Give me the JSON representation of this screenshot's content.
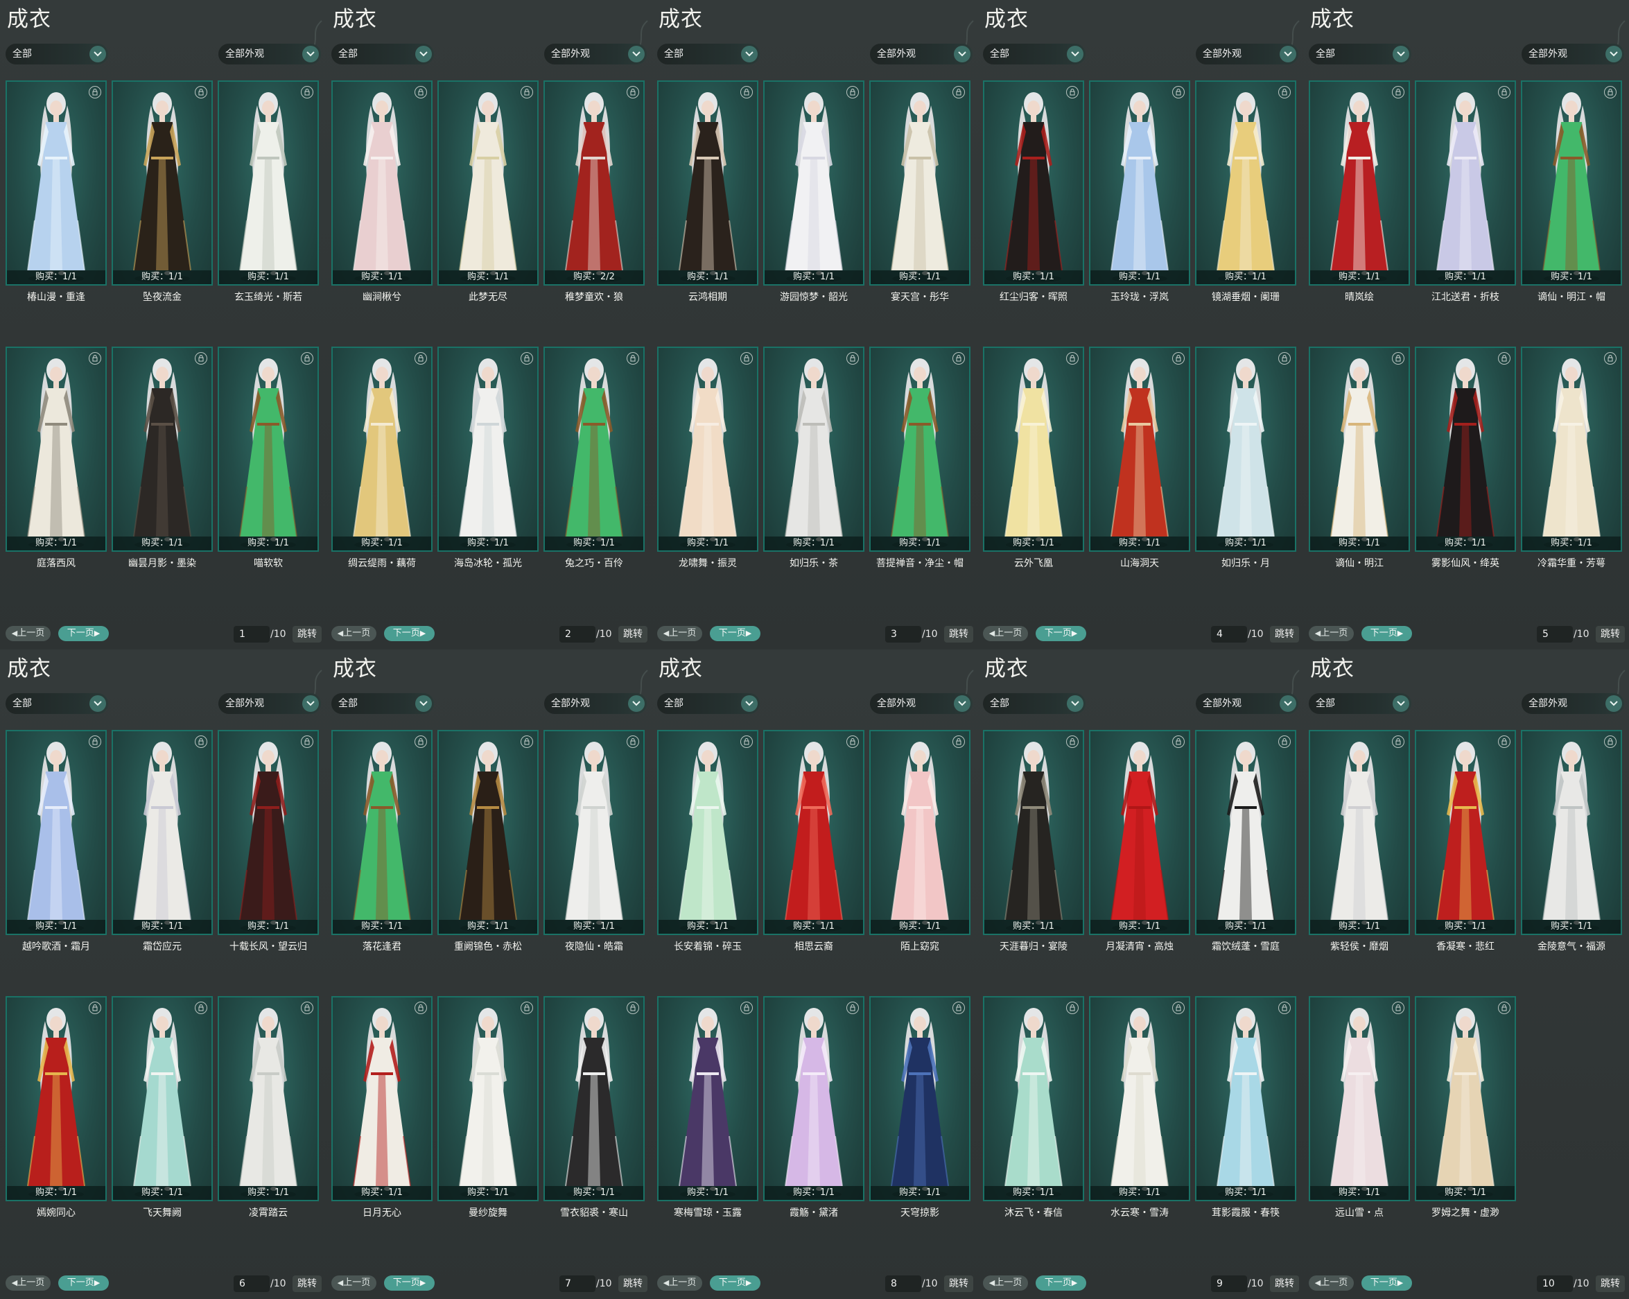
{
  "ui": {
    "title": "成衣",
    "category_filter": "全部",
    "appearance_filter": "全部外观",
    "prev_label": "上一页",
    "next_label": "下一页",
    "page_total": "/10",
    "jump_label": "跳转",
    "lock_icon": "lock-icon"
  },
  "panels": [
    {
      "page": "1",
      "items": [
        {
          "name": "椿山漫・重逢",
          "buy": "购买：1/1",
          "outfit": "#b7d2ee",
          "accent": "#e8f3fb"
        },
        {
          "name": "坠夜流金",
          "buy": "购买：1/1",
          "outfit": "#2a2219",
          "accent": "#c9a45a"
        },
        {
          "name": "玄玉绮光・斯若",
          "buy": "购买：1/1",
          "outfit": "#eef0ea",
          "accent": "#bfc6bd"
        },
        {
          "name": "庭落西风",
          "buy": "购买：1/1",
          "outfit": "#ece8dc",
          "accent": "#8f8a7c"
        },
        {
          "name": "幽昙月影・墨染",
          "buy": "购买：1/1",
          "outfit": "#2c2825",
          "accent": "#5b5046"
        },
        {
          "name": "喵软软",
          "buy": "购买：1/1",
          "outfit": "#43b86a",
          "accent": "#8a5a2a"
        }
      ]
    },
    {
      "page": "2",
      "items": [
        {
          "name": "幽涧楸兮",
          "buy": "购买：1/1",
          "outfit": "#e9cfd0",
          "accent": "#f6efee"
        },
        {
          "name": "此梦无尽",
          "buy": "购买：1/1",
          "outfit": "#efeadc",
          "accent": "#d8cfa4"
        },
        {
          "name": "稚梦童欢・狼",
          "buy": "购买：2/2",
          "outfit": "#a2231e",
          "accent": "#e2d5cf"
        },
        {
          "name": "绸云缇雨・藕荷",
          "buy": "购买：1/1",
          "outfit": "#e2c77c",
          "accent": "#f4ead2"
        },
        {
          "name": "海岛冰轮・孤光",
          "buy": "购买：1/1",
          "outfit": "#f0f0ee",
          "accent": "#cfd6d8"
        },
        {
          "name": "兔之巧・百伶",
          "buy": "购买：1/1",
          "outfit": "#43b86a",
          "accent": "#8a5a2a"
        }
      ]
    },
    {
      "page": "3",
      "items": [
        {
          "name": "云鸿相期",
          "buy": "购买：1/1",
          "outfit": "#2a221c",
          "accent": "#d9c9b6"
        },
        {
          "name": "游园惊梦・韶光",
          "buy": "购买：1/1",
          "outfit": "#f1f1f3",
          "accent": "#d8d8e2"
        },
        {
          "name": "宴天宫・彤华",
          "buy": "购买：1/1",
          "outfit": "#eeebdf",
          "accent": "#c9c1a8"
        },
        {
          "name": "龙啸舞・振灵",
          "buy": "购买：1/1",
          "outfit": "#f1dcc6",
          "accent": "#f7ede2"
        },
        {
          "name": "如归乐・茶",
          "buy": "购买：1/1",
          "outfit": "#e6e6e4",
          "accent": "#bdbdb8"
        },
        {
          "name": "菩提禅音・净尘・帽",
          "buy": "购买：1/1",
          "outfit": "#43b86a",
          "accent": "#8a5a2a"
        }
      ]
    },
    {
      "page": "4",
      "items": [
        {
          "name": "红尘归客・晖照",
          "buy": "购买：1/1",
          "outfit": "#221c1b",
          "accent": "#a8201d"
        },
        {
          "name": "玉玲珑・浮岚",
          "buy": "购买：1/1",
          "outfit": "#a9c7ea",
          "accent": "#e7eff9"
        },
        {
          "name": "镜湖垂烟・阑珊",
          "buy": "购买：1/1",
          "outfit": "#e8cd7c",
          "accent": "#f5ecd0"
        },
        {
          "name": "云外飞凰",
          "buy": "购买：1/1",
          "outfit": "#f0e2a2",
          "accent": "#f8f2d6"
        },
        {
          "name": "山海洞天",
          "buy": "购买：1/1",
          "outfit": "#c0321f",
          "accent": "#e9c8a0"
        },
        {
          "name": "如归乐・月",
          "buy": "购买：1/1",
          "outfit": "#cfe3e8",
          "accent": "#eef5f6"
        }
      ]
    },
    {
      "page": "5",
      "items": [
        {
          "name": "晴岚绘",
          "buy": "购买：1/1",
          "outfit": "#b81f22",
          "accent": "#f1ede6"
        },
        {
          "name": "江北送君・折枝",
          "buy": "购买：1/1",
          "outfit": "#c9c9e6",
          "accent": "#eceaf6"
        },
        {
          "name": "谪仙・明江・帽",
          "buy": "购买：1/1",
          "outfit": "#43b86a",
          "accent": "#8a5a2a"
        },
        {
          "name": "谪仙・明江",
          "buy": "购买：1/1",
          "outfit": "#f2efe6",
          "accent": "#d8b57a"
        },
        {
          "name": "雾影仙风・绛英",
          "buy": "购买：1/1",
          "outfit": "#1e1a1b",
          "accent": "#a3201d"
        },
        {
          "name": "冷霜华重・芳萼",
          "buy": "购买：1/1",
          "outfit": "#eee4cc",
          "accent": "#f7f2e4"
        }
      ]
    },
    {
      "page": "6",
      "items": [
        {
          "name": "越吟歌酒・霜月",
          "buy": "购买：1/1",
          "outfit": "#a9bfe9",
          "accent": "#e5ecfa"
        },
        {
          "name": "霜岱应元",
          "buy": "购买：1/1",
          "outfit": "#ebeae6",
          "accent": "#c9c9d4"
        },
        {
          "name": "十载长风・望云归",
          "buy": "购买：1/1",
          "outfit": "#3a1b1a",
          "accent": "#8e1e1c"
        },
        {
          "name": "嫣婉同心",
          "buy": "购买：1/1",
          "outfit": "#b81f1c",
          "accent": "#e6b64e"
        },
        {
          "name": "飞天舞阙",
          "buy": "购买：1/1",
          "outfit": "#a5d9cf",
          "accent": "#f1f4f1"
        },
        {
          "name": "凌霄踏云",
          "buy": "购买：1/1",
          "outfit": "#e8e8e4",
          "accent": "#c8cbc6"
        }
      ]
    },
    {
      "page": "7",
      "items": [
        {
          "name": "落花逢君",
          "buy": "购买：1/1",
          "outfit": "#43b86a",
          "accent": "#8a5a2a"
        },
        {
          "name": "重阙锦色・赤松",
          "buy": "购买：1/1",
          "outfit": "#2a1f17",
          "accent": "#b58a42"
        },
        {
          "name": "夜隐仙・皓霜",
          "buy": "购买：1/1",
          "outfit": "#eeeeec",
          "accent": "#cfd3d0"
        },
        {
          "name": "日月无心",
          "buy": "购买：1/1",
          "outfit": "#f0ece4",
          "accent": "#b31f1d"
        },
        {
          "name": "曼纱旋舞",
          "buy": "购买：1/1",
          "outfit": "#f2f1ec",
          "accent": "#dadcd5"
        },
        {
          "name": "雪衣貂裘・寒山",
          "buy": "购买：1/1",
          "outfit": "#2b2a2b",
          "accent": "#efefef"
        }
      ]
    },
    {
      "page": "8",
      "items": [
        {
          "name": "长安着锦・碎玉",
          "buy": "购买：1/1",
          "outfit": "#bfe6c9",
          "accent": "#eaf6ee"
        },
        {
          "name": "相思云裔",
          "buy": "购买：1/1",
          "outfit": "#c21d1d",
          "accent": "#ee6a5a"
        },
        {
          "name": "陌上窈窕",
          "buy": "购买：1/1",
          "outfit": "#f2c6c6",
          "accent": "#fbe9e6"
        },
        {
          "name": "寒梅雪琼・玉露",
          "buy": "购买：1/1",
          "outfit": "#4a3866",
          "accent": "#ece8f1"
        },
        {
          "name": "霞觞・黛渚",
          "buy": "购买：1/1",
          "outfit": "#d6b8e6",
          "accent": "#f4ebf8"
        },
        {
          "name": "天穹掠影",
          "buy": "购买：1/1",
          "outfit": "#1f3262",
          "accent": "#4d72b9"
        }
      ]
    },
    {
      "page": "9",
      "items": [
        {
          "name": "天涯暮归・宴陵",
          "buy": "购买：1/1",
          "outfit": "#262421",
          "accent": "#8f8a7a"
        },
        {
          "name": "月凝清宵・高烛",
          "buy": "购买：1/1",
          "outfit": "#d21f22",
          "accent": "#b01616"
        },
        {
          "name": "霜饮绒蓬・雪庭",
          "buy": "购买：1/1",
          "outfit": "#eeeeec",
          "accent": "#1b1b1b"
        },
        {
          "name": "沐云飞・春信",
          "buy": "购买：1/1",
          "outfit": "#a9dccb",
          "accent": "#eef6f2"
        },
        {
          "name": "水云寒・雪涛",
          "buy": "购买：1/1",
          "outfit": "#f1f0ea",
          "accent": "#dedbcf"
        },
        {
          "name": "茸影霞服・春筷",
          "buy": "购买：1/1",
          "outfit": "#a9d8e6",
          "accent": "#eef4f5"
        }
      ]
    },
    {
      "page": "10",
      "items": [
        {
          "name": "紫轻侯・靡烟",
          "buy": "购买：1/1",
          "outfit": "#ecebe8",
          "accent": "#cfcfd2"
        },
        {
          "name": "香凝寒・悲红",
          "buy": "购买：1/1",
          "outfit": "#be1f1e",
          "accent": "#e7b84e"
        },
        {
          "name": "金陵意气・福源",
          "buy": "购买：1/1",
          "outfit": "#e8e8e6",
          "accent": "#bfc4c4"
        },
        {
          "name": "远山雪・点",
          "buy": "购买：1/1",
          "outfit": "#ecdde0",
          "accent": "#f6eff0"
        },
        {
          "name": "罗姆之舞・虚渺",
          "buy": "购买：1/1",
          "outfit": "#e6d4b4",
          "accent": "#f4ecdc"
        }
      ]
    }
  ]
}
